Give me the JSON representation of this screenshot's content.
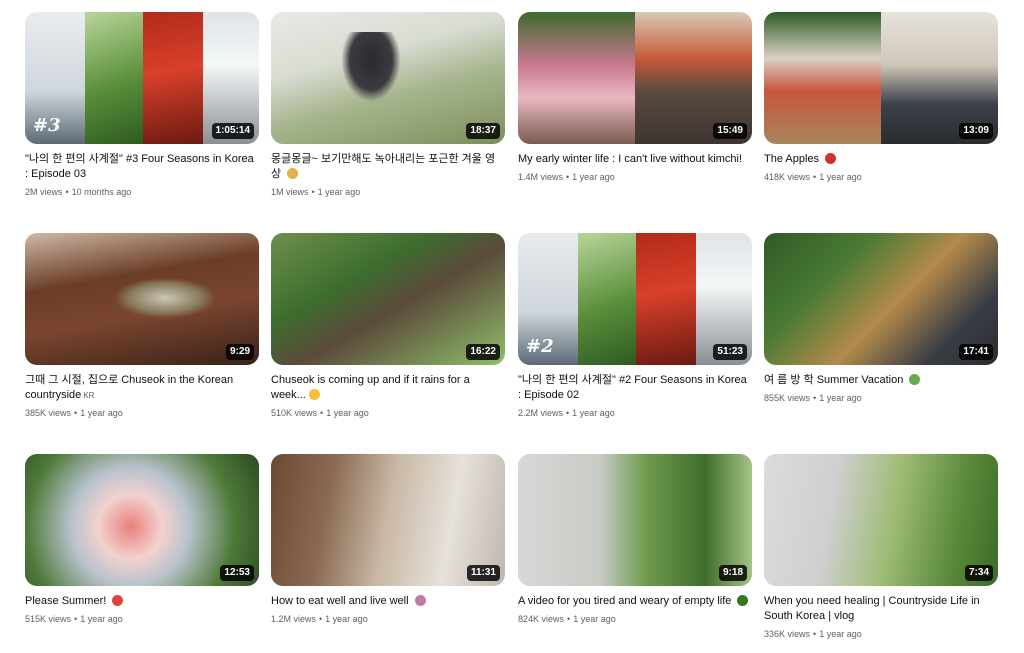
{
  "videos": [
    {
      "title": "\"나의 한 편의 사계절\" #3 Four Seasons in Korea : Episode 03",
      "views": "2M views",
      "age": "10 months ago",
      "duration": "1:05:14",
      "badge": "",
      "emoji": "",
      "overlay": "#3"
    },
    {
      "title": "몽글몽글~ 보기만해도 녹아내리는 포근한 겨울 영상 ",
      "views": "1M views",
      "age": "1 year ago",
      "duration": "18:37",
      "badge": "",
      "emoji": "egg-bowl",
      "overlay": ""
    },
    {
      "title": "My early winter life : I can't live without kimchi!",
      "views": "1.4M views",
      "age": "1 year ago",
      "duration": "15:49",
      "badge": "",
      "emoji": "",
      "overlay": ""
    },
    {
      "title": "The Apples ",
      "views": "418K views",
      "age": "1 year ago",
      "duration": "13:09",
      "badge": "",
      "emoji": "apple",
      "overlay": ""
    },
    {
      "title": "그때 그 시절, 집으로 Chuseok in the Korean countryside",
      "views": "385K views",
      "age": "1 year ago",
      "duration": "9:29",
      "badge": "KR",
      "emoji": "",
      "overlay": ""
    },
    {
      "title": "Chuseok is coming up and if it rains for a week...",
      "views": "510K views",
      "age": "1 year ago",
      "duration": "16:22",
      "badge": "",
      "emoji": "thinking-face",
      "overlay": ""
    },
    {
      "title": "\"나의 한 편의 사계절\" #2 Four Seasons in Korea : Episode 02",
      "views": "2.2M views",
      "age": "1 year ago",
      "duration": "51:23",
      "badge": "",
      "emoji": "",
      "overlay": "#2"
    },
    {
      "title": "여 름 방 학 Summer Vacation ",
      "views": "855K views",
      "age": "1 year ago",
      "duration": "17:41",
      "badge": "",
      "emoji": "farmer",
      "overlay": ""
    },
    {
      "title": "Please Summer! ",
      "views": "515K views",
      "age": "1 year ago",
      "duration": "12:53",
      "badge": "",
      "emoji": "watermelon",
      "overlay": ""
    },
    {
      "title": "How to eat well and live well ",
      "views": "1.2M views",
      "age": "1 year ago",
      "duration": "11:31",
      "badge": "",
      "emoji": "family",
      "overlay": ""
    },
    {
      "title": "A video for you tired and weary of empty life ",
      "views": "824K views",
      "age": "1 year ago",
      "duration": "9:18",
      "badge": "",
      "emoji": "leaf",
      "overlay": ""
    },
    {
      "title": "When you need healing | Countryside Life in South Korea | vlog",
      "views": "336K views",
      "age": "1 year ago",
      "duration": "7:34",
      "badge": "",
      "emoji": "",
      "overlay": ""
    }
  ],
  "meta_separator": "•"
}
